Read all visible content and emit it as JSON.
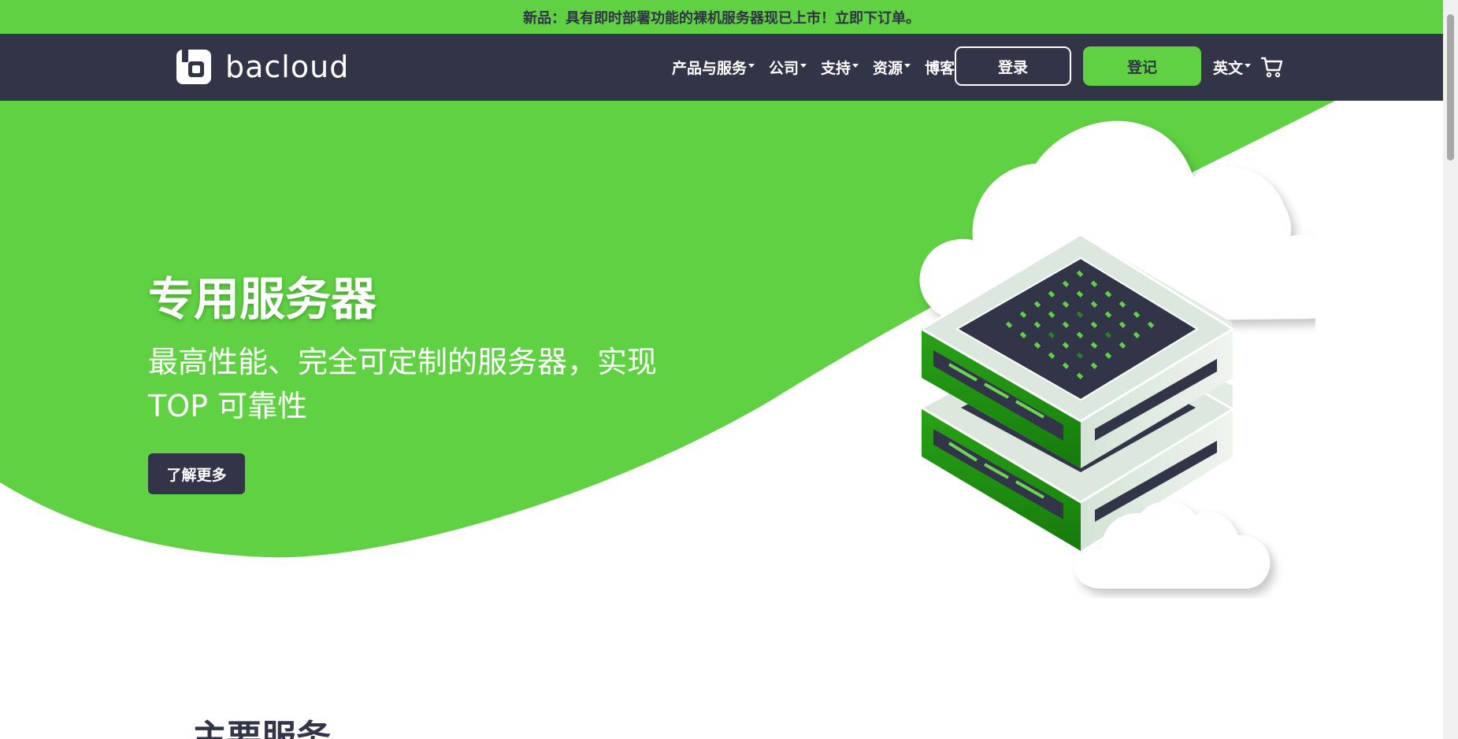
{
  "announcement": {
    "text": "新品：具有即时部署功能的裸机服务器现已上市！立即下订单。"
  },
  "header": {
    "logo_text": "bacloud",
    "logo_icon": "bacloud-logo-icon",
    "nav": [
      {
        "label": "产品与服务",
        "has_dropdown": true
      },
      {
        "label": "公司",
        "has_dropdown": true
      },
      {
        "label": "支持",
        "has_dropdown": true
      },
      {
        "label": "资源",
        "has_dropdown": true
      },
      {
        "label": "博客",
        "has_dropdown": false
      }
    ],
    "login_label": "登录",
    "register_label": "登记",
    "language_label": "英文",
    "cart_icon": "cart-icon"
  },
  "hero": {
    "title": "专用服务器",
    "subtitle": "最高性能、完全可定制的服务器，实现 TOP 可靠性",
    "cta_label": "了解更多",
    "illustration": "cloud-server-stack-illustration"
  },
  "services": {
    "title": "主要服务"
  },
  "colors": {
    "brand_green": "#5fd142",
    "navy": "#323447",
    "server_dark_green": "#1f8a12",
    "white": "#ffffff"
  }
}
